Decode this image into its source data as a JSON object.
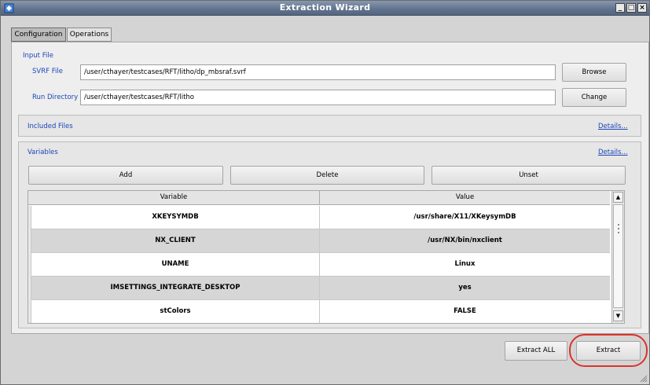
{
  "window": {
    "title": "Extraction Wizard"
  },
  "tabs": [
    {
      "label": "Configuration",
      "active": true
    },
    {
      "label": "Operations",
      "active": false
    }
  ],
  "input_file": {
    "section_label": "Input File",
    "svrf_label": "SVRF File",
    "svrf_value": "/user/cthayer/testcases/RFT/litho/dp_mbsraf.svrf",
    "browse_label": "Browse",
    "run_dir_label": "Run Directory",
    "run_dir_value": "/user/cthayer/testcases/RFT/litho",
    "change_label": "Change"
  },
  "included_files": {
    "label": "Included Files",
    "details": "Details..."
  },
  "variables": {
    "label": "Variables",
    "details": "Details...",
    "add_label": "Add",
    "delete_label": "Delete",
    "unset_label": "Unset",
    "columns": [
      "Variable",
      "Value"
    ],
    "rows": [
      {
        "variable": "XKEYSYMDB",
        "value": "/usr/share/X11/XKeysymDB"
      },
      {
        "variable": "NX_CLIENT",
        "value": "/usr/NX/bin/nxclient"
      },
      {
        "variable": "UNAME",
        "value": "Linux"
      },
      {
        "variable": "IMSETTINGS_INTEGRATE_DESKTOP",
        "value": "yes"
      },
      {
        "variable": "stColors",
        "value": "FALSE"
      }
    ]
  },
  "footer": {
    "extract_all_label": "Extract ALL",
    "extract_label": "Extract"
  },
  "colors": {
    "title_bar": "#60728d",
    "link": "#1b46b8",
    "highlight_ring": "#d9342b"
  }
}
